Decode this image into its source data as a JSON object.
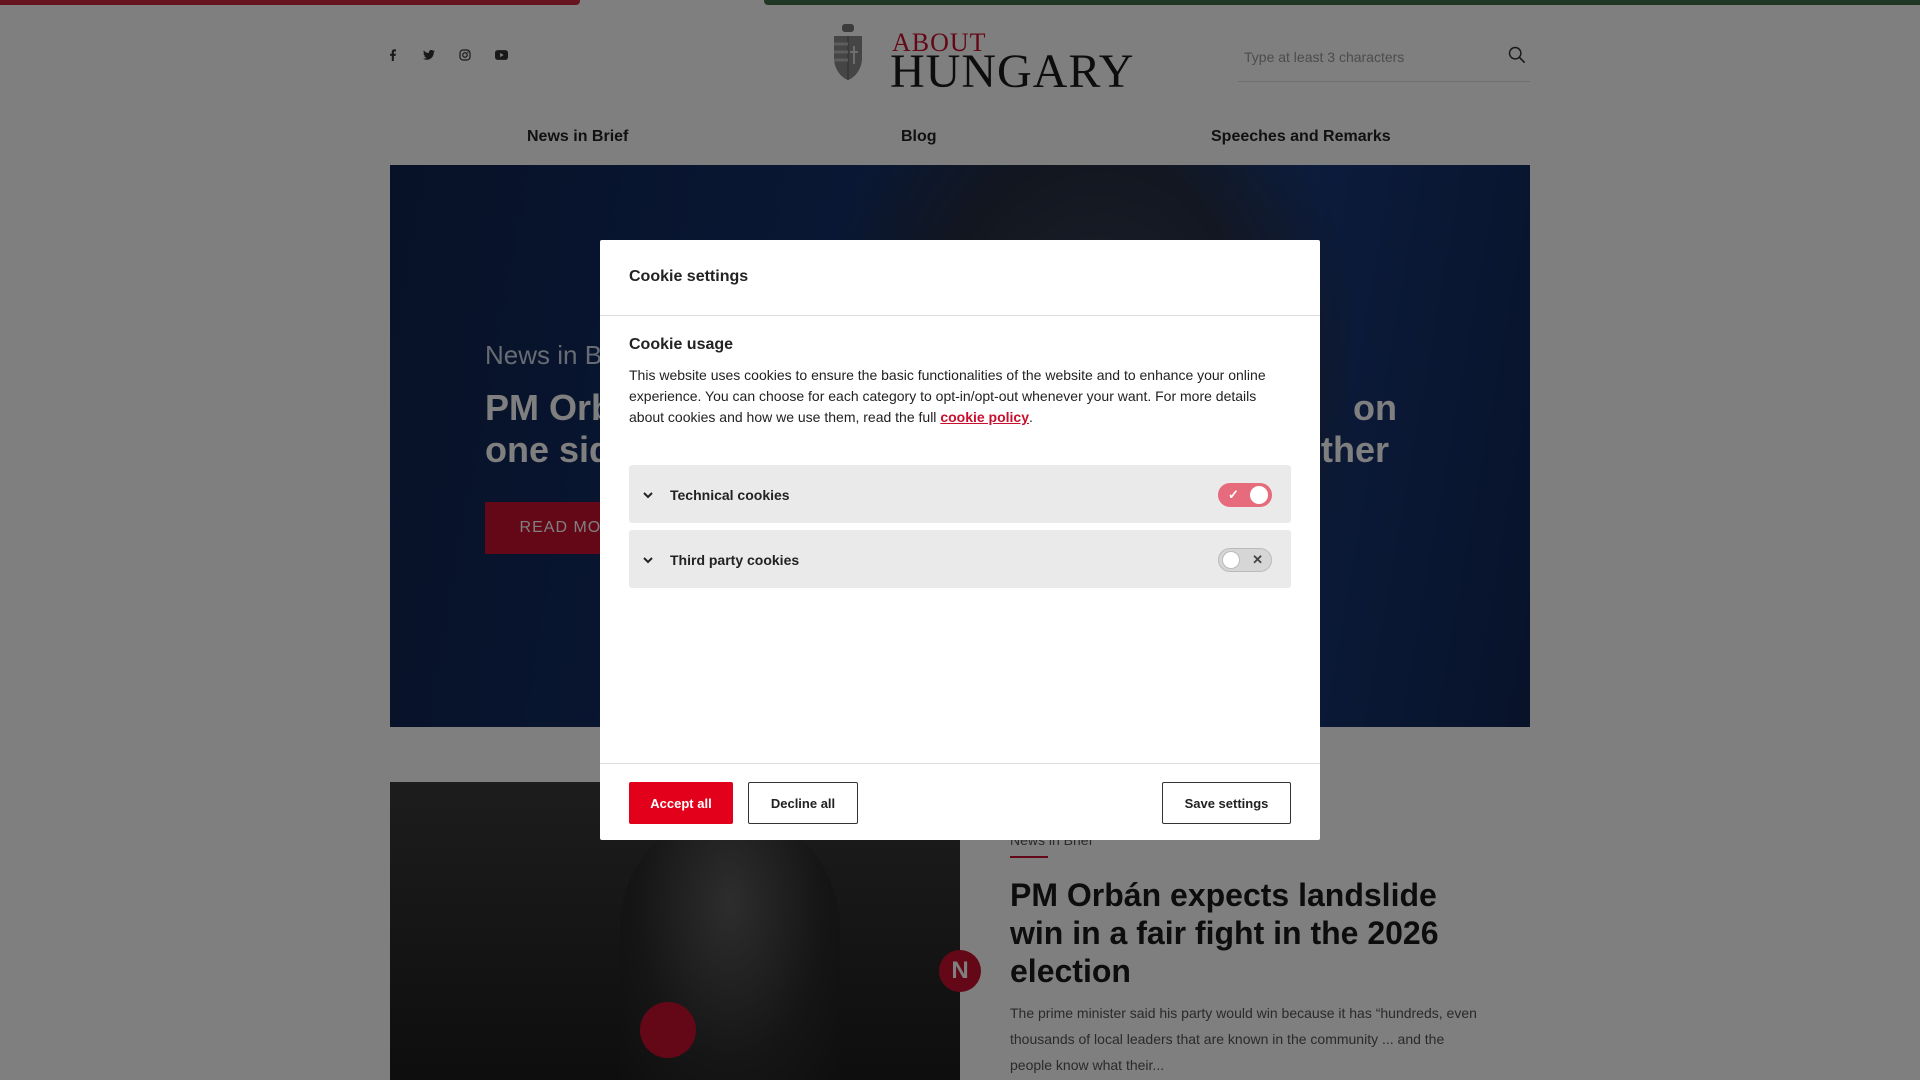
{
  "header": {
    "social_icons": [
      "facebook-icon",
      "twitter-icon",
      "instagram-icon",
      "youtube-icon"
    ],
    "logo": {
      "top": "ABOUT",
      "bottom": "HUNGARY"
    },
    "search": {
      "placeholder": "Type at least 3 characters"
    }
  },
  "nav": {
    "items": [
      {
        "label": "News in Brief"
      },
      {
        "label": "Blog"
      },
      {
        "label": "Speeches and Remarks"
      }
    ]
  },
  "hero": {
    "category": "News in Brief",
    "title_left_1": "PM Orb",
    "title_left_2": "one sid",
    "title_right_1": "on",
    "title_right_2": "other",
    "read_more": "READ MORE"
  },
  "article": {
    "badge": "N",
    "category": "News in Brief",
    "title": "PM Orbán expects landslide win in a fair fight in the 2026 election",
    "excerpt": "The prime minister said his party would win because it has “hundreds, even thousands of local leaders that are known in the community ... and the people know what their..."
  },
  "cookie_modal": {
    "title": "Cookie settings",
    "usage_heading": "Cookie usage",
    "usage_text": "This website uses cookies to ensure the basic functionalities of the website and to enhance your online experience. You can choose for each category to opt-in/opt-out whenever your want. For more details about cookies and how we use them, read the full ",
    "policy_link": "cookie policy",
    "usage_text_end": ".",
    "categories": [
      {
        "label": "Technical cookies",
        "enabled": true,
        "mark": "✓"
      },
      {
        "label": "Third party cookies",
        "enabled": false,
        "mark": "✕"
      }
    ],
    "buttons": {
      "accept": "Accept all",
      "decline": "Decline all",
      "save": "Save settings"
    }
  },
  "colors": {
    "brand_red": "#c8102e",
    "accept_red": "#e2001a",
    "flag_green": "#436f4d"
  }
}
